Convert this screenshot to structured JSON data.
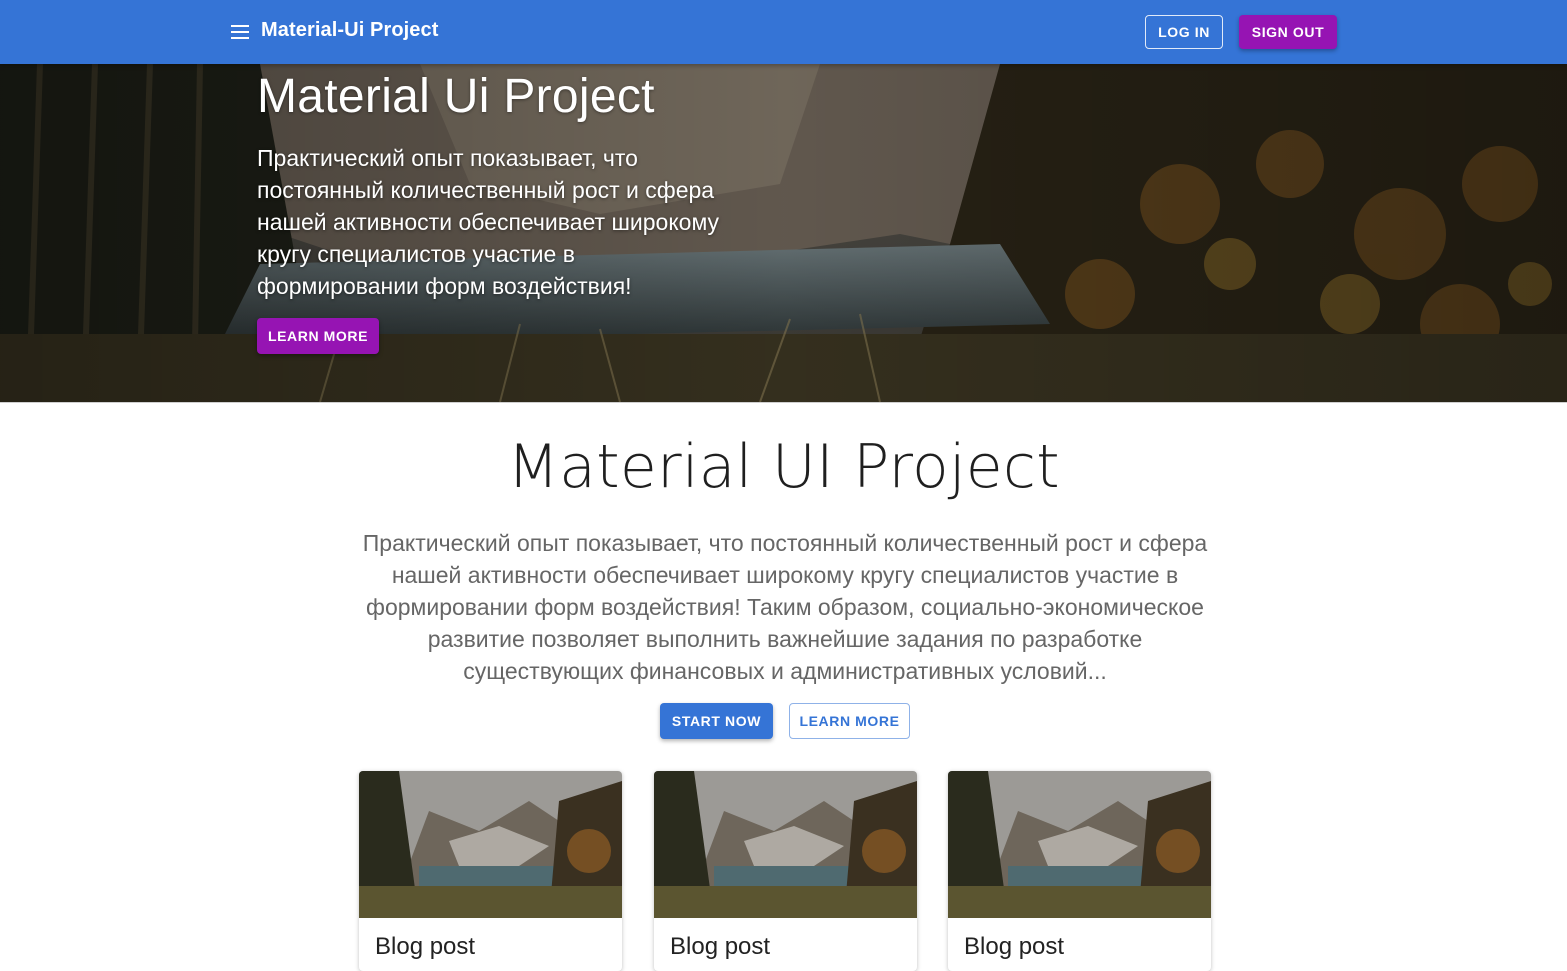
{
  "appbar": {
    "title": "Material-Ui Project",
    "login_label": "LOG IN",
    "signout_label": "SIGN OUT",
    "color": "#3574d6"
  },
  "hero": {
    "title": "Material Ui Project",
    "text": "Практический опыт показывает, что постоянный количественный рост и сфера нашей активности обеспечивает широкому кругу специалистов участие в формировании форм воздействия!",
    "button_label": "LEARN MORE",
    "button_color": "#9614b3"
  },
  "main": {
    "title": "Material UI Project",
    "text": "Практический опыт показывает, что постоянный количественный рост и сфера нашей активности обеспечивает широкому кругу специалистов участие в формировании форм воздействия! Таким образом, социально-экономическое развитие позволяет выполнить важнейшие задания по разработке существующих финансовых и административных условий...",
    "start_label": "START NOW",
    "learn_label": "LEARN MORE"
  },
  "cards": [
    {
      "title": "Blog post"
    },
    {
      "title": "Blog post"
    },
    {
      "title": "Blog post"
    }
  ]
}
